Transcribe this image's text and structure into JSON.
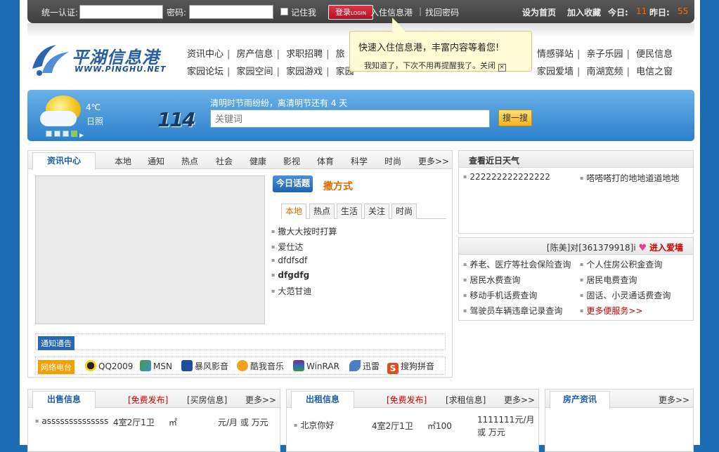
{
  "topbar": {
    "login_label": "统一认证:",
    "password_label": "密码:",
    "remember_label": "记住我",
    "login_button": "登录",
    "login_button_en": "LOGIN",
    "join_link": "入住信息港",
    "separator": "|",
    "find_password": "找回密码",
    "set_home": "设为首页",
    "add_fav": "加入收藏",
    "today_label": "今日:",
    "today_count": "11",
    "yesterday_label": "昨日:",
    "yesterday_count": "55"
  },
  "logo": {
    "cn": "平湖信息港",
    "en": "WWW.PINGHU.NET"
  },
  "nav": {
    "row1": [
      "资讯中心",
      "房产信息",
      "求职招聘",
      "旅",
      "情感驿站",
      "亲子乐园",
      "便民信息"
    ],
    "row2": [
      "家园论坛",
      "家园空间",
      "家园游戏",
      "家园",
      "家园爱墙",
      "南湖宽频",
      "电信之窗"
    ]
  },
  "tip": {
    "message": "快速入住信息港，丰富内容等着您!",
    "dismiss": "我知道了，下次不用再提醒我了。关闭"
  },
  "search": {
    "temp": "4℃",
    "weather": "日照",
    "hotline": "114",
    "holiday": "清明时节雨纷纷，离清明节还有 4 天",
    "placeholder": "关键词",
    "button": "搜一搜"
  },
  "news": {
    "active_tab": "资讯中心",
    "tabs": [
      "本地",
      "通知",
      "热点",
      "社会",
      "健康",
      "影视",
      "体育",
      "科学",
      "时尚",
      "更多>>"
    ],
    "today_label": "今日话题",
    "today_title": "撒方式",
    "subtabs": [
      "本地",
      "热点",
      "生活",
      "关注",
      "时尚"
    ],
    "items": [
      "撒大大按时打算",
      "爱仕达",
      "dfdfsdf",
      "dfgdfg",
      "大范甘迪"
    ],
    "notice_label": "通知通告",
    "apps_label": "网络电台",
    "apps": [
      "QQ2009",
      "MSN",
      "暴风影音",
      "酷我音乐",
      "WinRAR",
      "迅雷",
      "搜狗拼音"
    ]
  },
  "weather_box": {
    "title": "查看近日天气",
    "items": [
      "222222222222222",
      "嗒嗒嗒打的地地道道地地"
    ]
  },
  "services": {
    "love_from": "[陈美]对[361379918]i",
    "love_link": "进入爱墙",
    "items": [
      "养老、医疗等社会保险查询",
      "个人住房公积金查询",
      "居民水费查询",
      "居民电费查询",
      "移动手机话费查询",
      "固话、小灵通话费查询",
      "驾驶员车辆违章记录查询",
      "更多便服务>>"
    ]
  },
  "sale": {
    "title": "出售信息",
    "free": "[免费发布]",
    "buy": "[买房信息]",
    "more": "更多>>",
    "row": {
      "name": "assssssssssssss",
      "layout": "4室2厅1卫",
      "area": "㎡",
      "price": "元/月 或 万元"
    }
  },
  "rent": {
    "title": "出租信息",
    "free": "[免费发布]",
    "seek": "[求租信息]",
    "more": "更多>>",
    "row": {
      "name": "北京你好",
      "layout": "4室2厅1卫",
      "area": "㎡100",
      "price1": "1111111元/月",
      "price2": "或 万元"
    }
  },
  "house": {
    "title": "房产资讯",
    "more": "更多>>"
  }
}
